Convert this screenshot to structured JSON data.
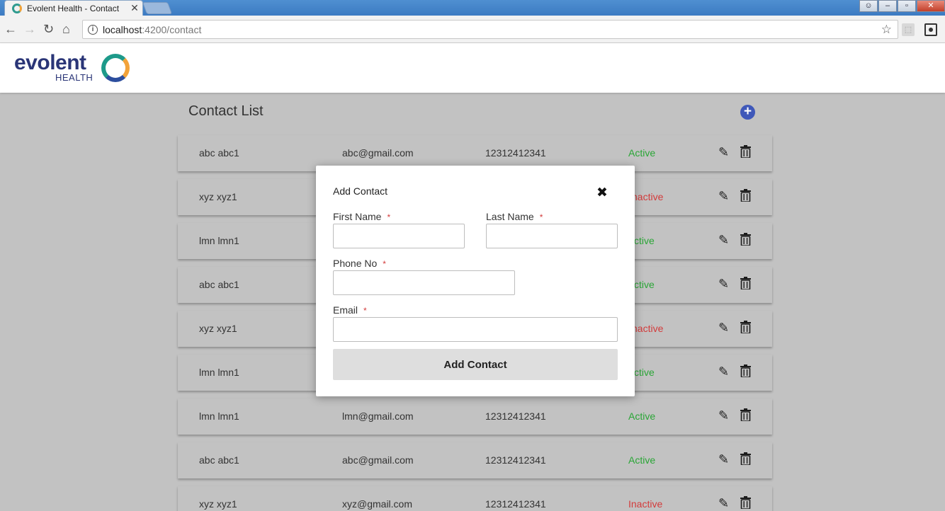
{
  "browser": {
    "tab_title": "Evolent Health - Contact",
    "tab_close": "✕",
    "back_icon": "back-arrow-icon",
    "url_host": "localhost",
    "url_rest": ":4200/contact"
  },
  "header": {
    "logo_word": "evolent",
    "logo_sub": "HEALTH"
  },
  "contact_list": {
    "title": "Contact List",
    "add_button": "+",
    "rows": [
      {
        "name": "abc abc1",
        "email": "abc@gmail.com",
        "phone": "12312412341",
        "status": "Active"
      },
      {
        "name": "xyz xyz1",
        "email": "",
        "phone": "",
        "status": "Inactive",
        "partial": "nactive"
      },
      {
        "name": "lmn lmn1",
        "email": "",
        "phone": "",
        "status": "Active",
        "partial": "ctive"
      },
      {
        "name": "abc abc1",
        "email": "",
        "phone": "",
        "status": "Active",
        "partial": "ctive"
      },
      {
        "name": "xyz xyz1",
        "email": "",
        "phone": "",
        "status": "Inactive",
        "partial": "nactive"
      },
      {
        "name": "lmn lmn1",
        "email": "",
        "phone": "",
        "status": "Active",
        "partial": "ctive"
      },
      {
        "name": "lmn lmn1",
        "email": "lmn@gmail.com",
        "phone": "12312412341",
        "status": "Active"
      },
      {
        "name": "abc abc1",
        "email": "abc@gmail.com",
        "phone": "12312412341",
        "status": "Active"
      },
      {
        "name": "xyz xyz1",
        "email": "xyz@gmail.com",
        "phone": "12312412341",
        "status": "Inactive"
      }
    ]
  },
  "modal": {
    "title": "Add Contact",
    "close": "✖",
    "first_name_label": "First Name",
    "last_name_label": "Last Name",
    "phone_label": "Phone No",
    "email_label": "Email",
    "required_mark": "*",
    "first_name_value": "",
    "last_name_value": "",
    "phone_value": "",
    "email_value": "",
    "submit_label": "Add Contact"
  },
  "colors": {
    "active": "#2aa636",
    "inactive": "#d33b3b",
    "accent": "#3f58b9",
    "brand": "#2a3577"
  }
}
